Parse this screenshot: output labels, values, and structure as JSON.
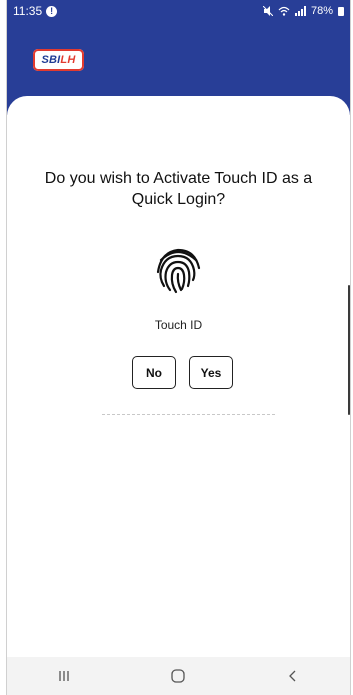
{
  "status_bar": {
    "time": "11:35",
    "notification_icon": "info-badge-icon",
    "icons": [
      "mute-icon",
      "wifi-icon",
      "signal-icon"
    ],
    "battery": "78%"
  },
  "header": {
    "logo_part1": "SBI",
    "logo_part2": "LH",
    "brand_color": "#283e97",
    "accent_color": "#e23a2f"
  },
  "dialog": {
    "prompt": "Do you wish to Activate Touch ID as a Quick Login?",
    "icon": "fingerprint-icon",
    "label": "Touch ID",
    "no_label": "No",
    "yes_label": "Yes"
  },
  "nav_bar": {
    "buttons": [
      "recent-apps-icon",
      "home-icon",
      "back-icon"
    ]
  }
}
